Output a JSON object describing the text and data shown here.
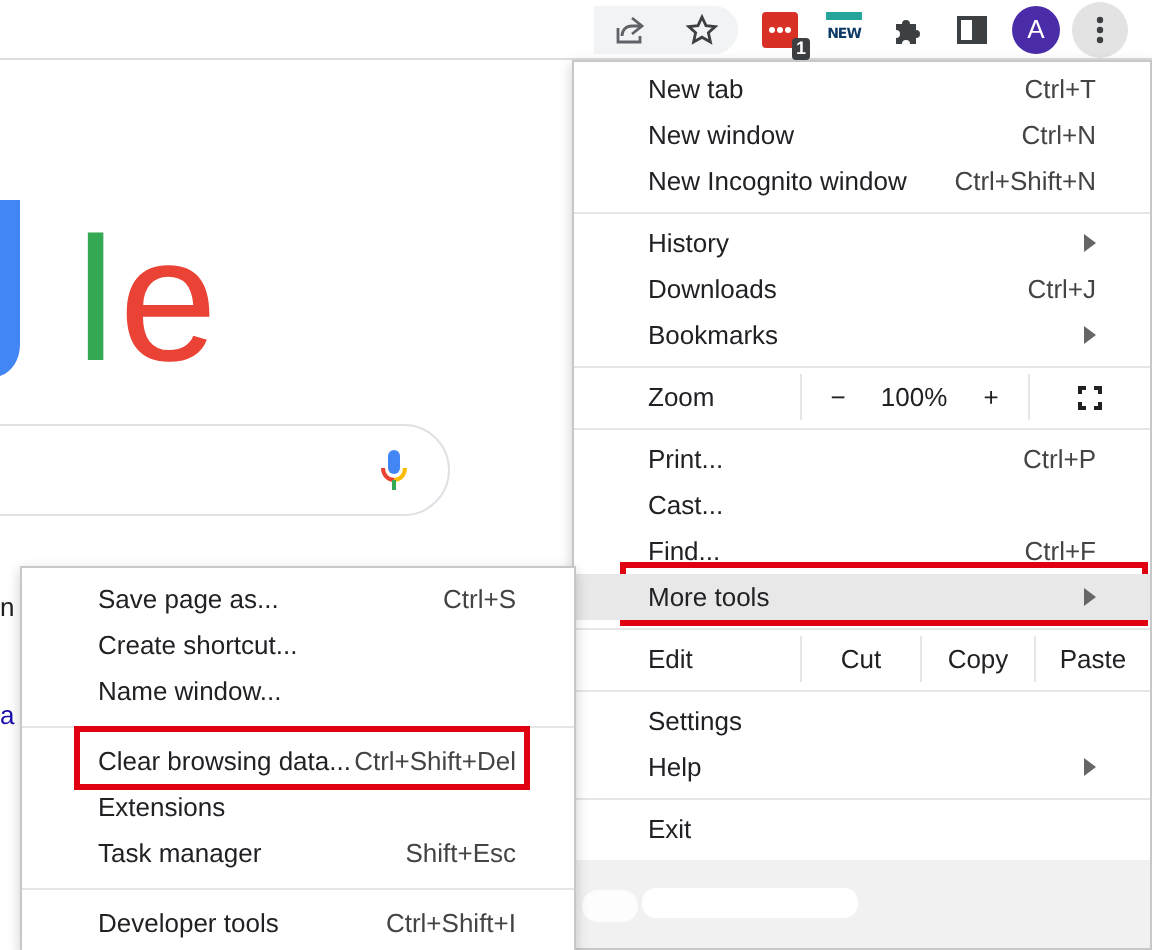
{
  "toolbar": {
    "extension_badge": "1",
    "extension_label": "NEW",
    "avatar": "A",
    "menu_open": true
  },
  "page": {
    "logo": [
      {
        "text": "l",
        "color": "#34a853"
      },
      {
        "text": "e",
        "color": "#ea4335"
      }
    ],
    "cut_texts": [
      {
        "text": "n",
        "kind": "plain"
      },
      {
        "text": "a",
        "kind": "link"
      }
    ]
  },
  "menu": {
    "items": [
      {
        "kind": "item",
        "label": "New tab",
        "shortcut": "Ctrl+T",
        "highlighted": false,
        "outlined": false
      },
      {
        "kind": "item",
        "label": "New window",
        "shortcut": "Ctrl+N",
        "highlighted": false,
        "outlined": false
      },
      {
        "kind": "item",
        "label": "New Incognito window",
        "shortcut": "Ctrl+Shift+N",
        "highlighted": false,
        "outlined": false
      },
      {
        "kind": "divider"
      },
      {
        "kind": "submenu",
        "label": "History",
        "highlighted": false,
        "outlined": false
      },
      {
        "kind": "item",
        "label": "Downloads",
        "shortcut": "Ctrl+J",
        "highlighted": false,
        "outlined": false
      },
      {
        "kind": "submenu",
        "label": "Bookmarks",
        "highlighted": false,
        "outlined": false
      },
      {
        "kind": "divider"
      },
      {
        "kind": "zoom",
        "label": "Zoom",
        "minus": "−",
        "level": "100%",
        "plus": "+"
      },
      {
        "kind": "divider"
      },
      {
        "kind": "item",
        "label": "Print...",
        "shortcut": "Ctrl+P",
        "highlighted": false,
        "outlined": false
      },
      {
        "kind": "item",
        "label": "Cast...",
        "highlighted": false,
        "outlined": false
      },
      {
        "kind": "item",
        "label": "Find...",
        "shortcut": "Ctrl+F",
        "highlighted": false,
        "outlined": false
      },
      {
        "kind": "submenu",
        "label": "More tools",
        "highlighted": true,
        "outlined": true
      },
      {
        "kind": "divider"
      },
      {
        "kind": "edit",
        "label": "Edit",
        "buttons": [
          "Cut",
          "Copy",
          "Paste"
        ]
      },
      {
        "kind": "divider"
      },
      {
        "kind": "item",
        "label": "Settings",
        "highlighted": false,
        "outlined": false
      },
      {
        "kind": "submenu",
        "label": "Help",
        "highlighted": false,
        "outlined": false
      },
      {
        "kind": "divider"
      },
      {
        "kind": "item",
        "label": "Exit",
        "highlighted": false,
        "outlined": false
      }
    ]
  },
  "submenu": {
    "items": [
      {
        "kind": "item",
        "label": "Save page as...",
        "shortcut": "Ctrl+S",
        "highlighted": false,
        "outlined": false
      },
      {
        "kind": "item",
        "label": "Create shortcut...",
        "highlighted": false,
        "outlined": false
      },
      {
        "kind": "item",
        "label": "Name window...",
        "highlighted": false,
        "outlined": false
      },
      {
        "kind": "divider"
      },
      {
        "kind": "item",
        "label": "Clear browsing data...",
        "shortcut": "Ctrl+Shift+Del",
        "highlighted": false,
        "outlined": true
      },
      {
        "kind": "item",
        "label": "Extensions",
        "highlighted": false,
        "outlined": false
      },
      {
        "kind": "item",
        "label": "Task manager",
        "shortcut": "Shift+Esc",
        "highlighted": false,
        "outlined": false
      },
      {
        "kind": "divider"
      },
      {
        "kind": "item",
        "label": "Developer tools",
        "shortcut": "Ctrl+Shift+I",
        "highlighted": false,
        "outlined": false
      }
    ]
  }
}
